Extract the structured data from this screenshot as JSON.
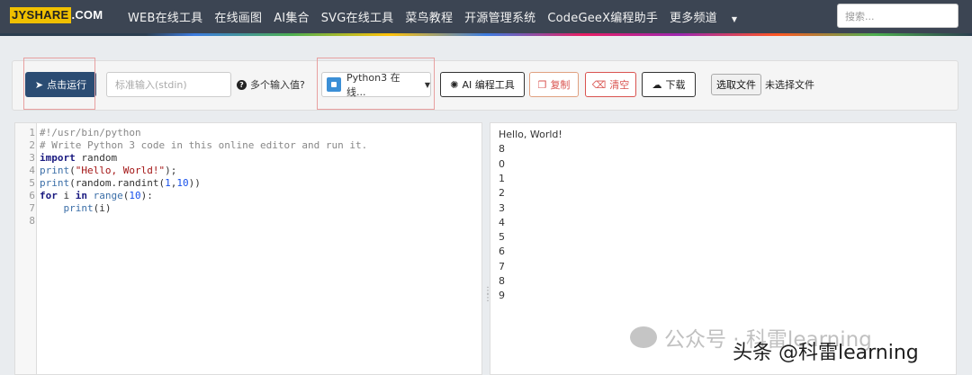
{
  "brand": {
    "logo_part1": "JYSHARE",
    "logo_part2": ".COM"
  },
  "nav": {
    "items": [
      "WEB在线工具",
      "在线画图",
      "AI集合",
      "SVG在线工具",
      "菜鸟教程",
      "开源管理系统",
      "CodeGeeX编程助手",
      "更多频道"
    ],
    "search_placeholder": "搜索..."
  },
  "toolbar": {
    "run_label": "点击运行",
    "stdin_placeholder": "标准输入(stdin)",
    "multi_input_label": "多个输入值?",
    "language_selected": "Python3 在线...",
    "ai_tool_label": "AI 编程工具",
    "copy_label": "复制",
    "clear_label": "清空",
    "download_label": "下载",
    "choose_file_label": "选取文件",
    "no_file_label": "未选择文件"
  },
  "editor": {
    "line_numbers": [
      "1",
      "2",
      "3",
      "4",
      "5",
      "6",
      "7",
      "8"
    ],
    "lines": [
      [
        {
          "t": "#!/usr/bin/python",
          "c": "cmt"
        }
      ],
      [
        {
          "t": "# Write Python 3 code in this online editor and run it.",
          "c": "cmt"
        }
      ],
      [
        {
          "t": "import",
          "c": "kw"
        },
        {
          "t": " random",
          "c": ""
        }
      ],
      [
        {
          "t": "print",
          "c": "fn"
        },
        {
          "t": "(",
          "c": ""
        },
        {
          "t": "\"Hello, World!\"",
          "c": "str"
        },
        {
          "t": ");",
          "c": ""
        }
      ],
      [
        {
          "t": "print",
          "c": "fn"
        },
        {
          "t": "(random.randint(",
          "c": ""
        },
        {
          "t": "1",
          "c": "num"
        },
        {
          "t": ",",
          "c": ""
        },
        {
          "t": "10",
          "c": "num"
        },
        {
          "t": "))",
          "c": ""
        }
      ],
      [
        {
          "t": "for",
          "c": "kw"
        },
        {
          "t": " i ",
          "c": ""
        },
        {
          "t": "in",
          "c": "kw"
        },
        {
          "t": " ",
          "c": ""
        },
        {
          "t": "range",
          "c": "fn"
        },
        {
          "t": "(",
          "c": ""
        },
        {
          "t": "10",
          "c": "num"
        },
        {
          "t": "):",
          "c": ""
        }
      ],
      [
        {
          "t": "    ",
          "c": ""
        },
        {
          "t": "print",
          "c": "fn"
        },
        {
          "t": "(i)",
          "c": ""
        }
      ],
      []
    ]
  },
  "output": {
    "lines": [
      "Hello, World!",
      "8",
      "0",
      "1",
      "2",
      "3",
      "4",
      "5",
      "6",
      "7",
      "8",
      "9"
    ]
  },
  "watermark": {
    "line1": "公众号 · 科雷learning",
    "line2": "头条 @科雷learning"
  },
  "colors": {
    "navbar": "#3c4553",
    "run_button": "#2b4c73",
    "danger": "#d9534f"
  }
}
